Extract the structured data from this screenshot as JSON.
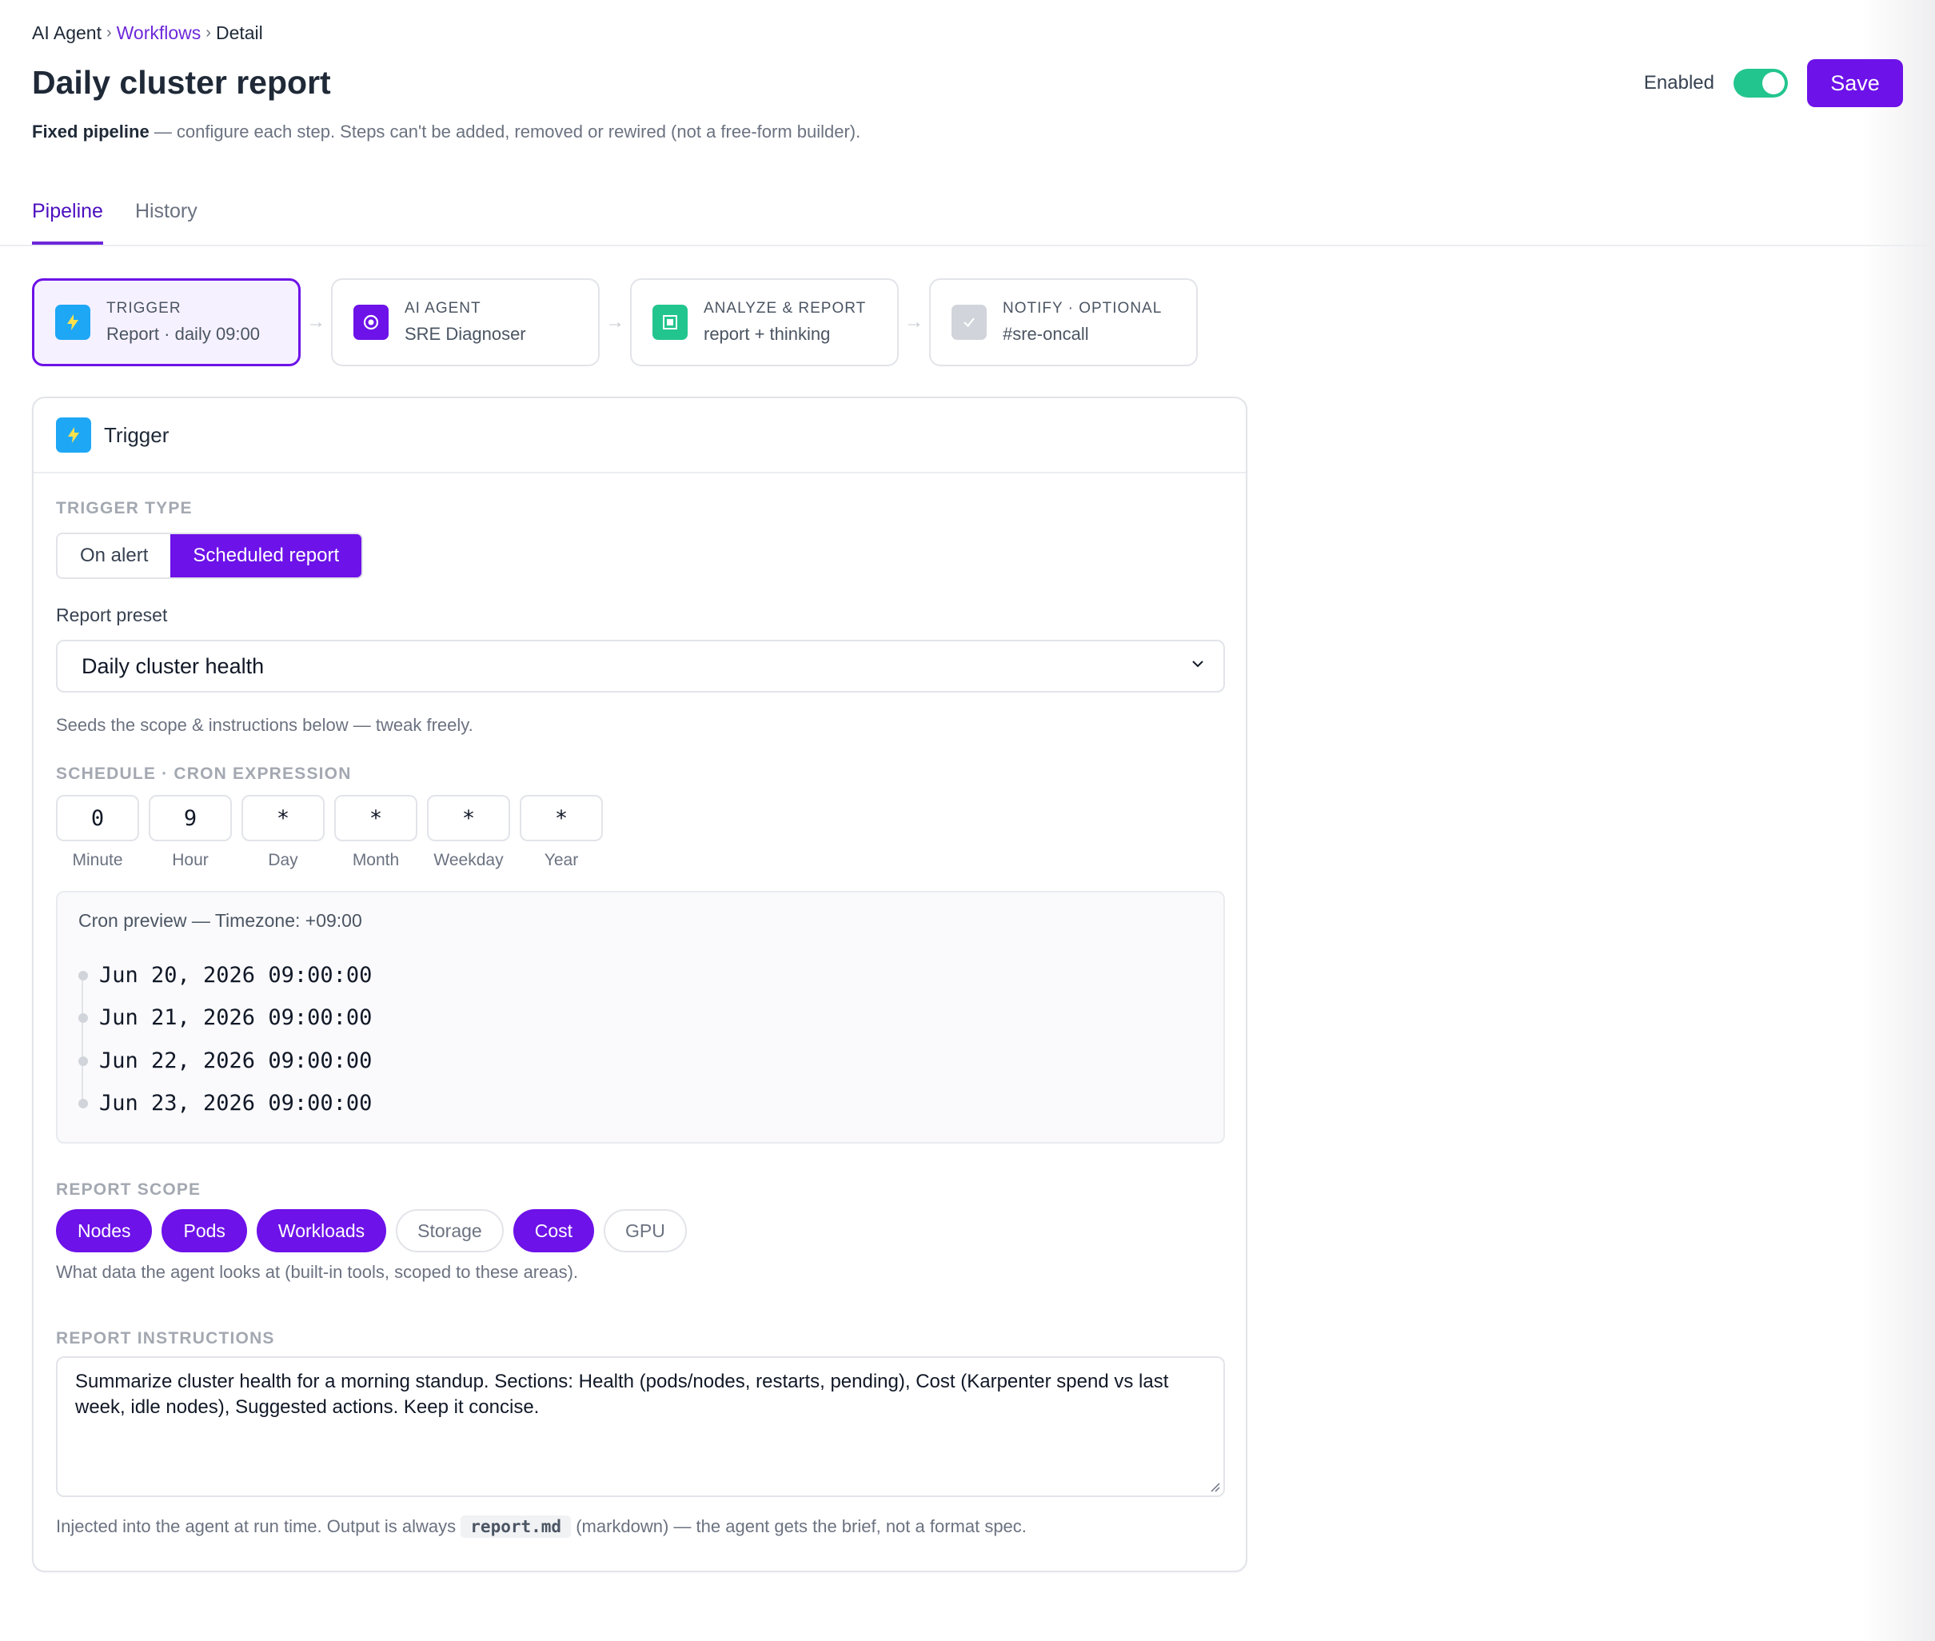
{
  "breadcrumb": {
    "root": "AI Agent",
    "sep": "›",
    "section": "Workflows",
    "current": "Detail"
  },
  "page": {
    "title": "Daily cluster report",
    "subtitle_bold": "Fixed pipeline",
    "subtitle_rest": " — configure each step. Steps can't be added, removed or rewired (not a free-form builder)."
  },
  "header": {
    "enabled_label": "Enabled",
    "enabled": true,
    "save_label": "Save"
  },
  "tabs": [
    {
      "label": "Pipeline",
      "active": true
    },
    {
      "label": "History",
      "active": false
    }
  ],
  "steps": [
    {
      "label": "TRIGGER",
      "sub": "Report · daily 09:00",
      "icon": "lightning-icon",
      "color": "#1ea7f5",
      "active": true
    },
    {
      "label": "AI AGENT",
      "sub": "SRE Diagnoser",
      "icon": "target-icon",
      "color": "#6d12e8",
      "active": false
    },
    {
      "label": "ANALYZE & REPORT",
      "sub": "report + thinking",
      "icon": "report-icon",
      "color": "#22c58e",
      "active": false
    },
    {
      "label": "NOTIFY · OPTIONAL",
      "sub": "#sre-oncall",
      "icon": "check-icon",
      "color": "#d1d4da",
      "active": false
    }
  ],
  "step_arrow": "→",
  "card": {
    "title": "Trigger",
    "trigger_type_label": "TRIGGER TYPE",
    "trigger_options": [
      {
        "label": "On alert",
        "active": false
      },
      {
        "label": "Scheduled report",
        "active": true
      }
    ],
    "preset_label": "Report preset",
    "preset_value": "Daily cluster health",
    "preset_hint": "Seeds the scope & instructions below — tweak freely.",
    "schedule_label": "SCHEDULE · CRON EXPRESSION",
    "cron": [
      {
        "value": "0",
        "caption": "Minute"
      },
      {
        "value": "9",
        "caption": "Hour"
      },
      {
        "value": "*",
        "caption": "Day"
      },
      {
        "value": "*",
        "caption": "Month"
      },
      {
        "value": "*",
        "caption": "Weekday"
      },
      {
        "value": "*",
        "caption": "Year"
      }
    ],
    "preview_title": "Cron preview — Timezone: +09:00",
    "preview_dates": [
      "Jun 20, 2026 09:00:00",
      "Jun 21, 2026 09:00:00",
      "Jun 22, 2026 09:00:00",
      "Jun 23, 2026 09:00:00"
    ],
    "scope_label": "REPORT SCOPE",
    "scope": [
      {
        "label": "Nodes",
        "on": true
      },
      {
        "label": "Pods",
        "on": true
      },
      {
        "label": "Workloads",
        "on": true
      },
      {
        "label": "Storage",
        "on": false
      },
      {
        "label": "Cost",
        "on": true
      },
      {
        "label": "GPU",
        "on": false
      }
    ],
    "scope_hint": "What data the agent looks at (built-in tools, scoped to these areas).",
    "instructions_label": "REPORT INSTRUCTIONS",
    "instructions": "Summarize cluster health for a morning standup. Sections: Health (pods/nodes, restarts, pending), Cost (Karpenter spend vs last week, idle nodes), Suggested actions. Keep it concise.",
    "footer_pre": "Injected into the agent at run time. Output is always ",
    "footer_code": "report.md",
    "footer_post": " (markdown) — the agent gets the brief, not a format spec."
  },
  "colors": {
    "accent": "#6d12e8",
    "toggle_on": "#22c58e",
    "link": "#6d28d9"
  }
}
